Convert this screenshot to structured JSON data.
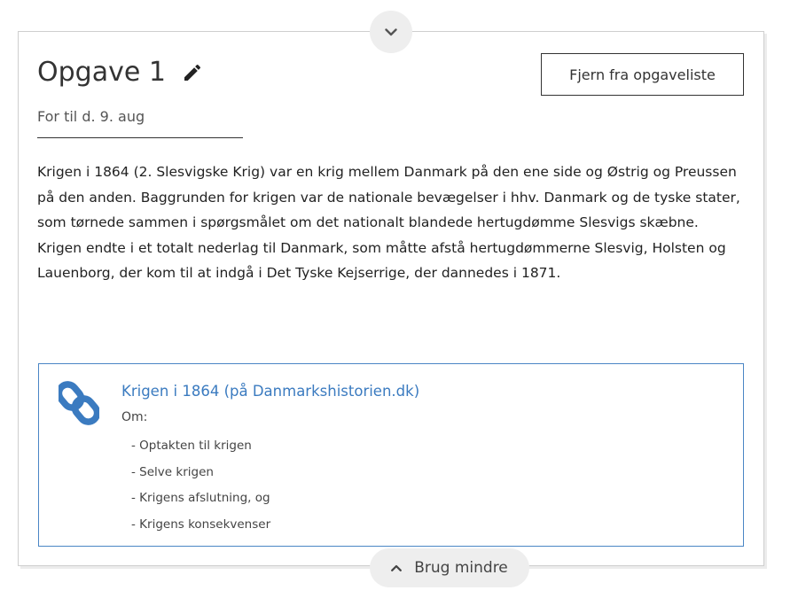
{
  "task": {
    "title": "Opgave 1",
    "due": "For til d. 9. aug",
    "remove_button": "Fjern fra opgaveliste",
    "description": "Krigen i 1864 (2. Slesvigske Krig) var en krig mellem Danmark på den ene side og Østrig og Preussen på den anden. Baggrunden for krigen var de nationale bevægelser i hhv. Danmark og de tyske stater, som tørnede sammen i spørgsmålet om det nationalt blandede hertugdømme Slesvigs skæbne. Krigen endte i et totalt nederlag til Danmark, som måtte afstå hertugdømmerne Slesvig, Holsten og Lauenborg, der kom til at indgå i Det Tyske Kejserrige, der dannedes i 1871."
  },
  "resource": {
    "title": "Krigen i 1864 (på Danmarkshistorien.dk)",
    "subtitle": "Om:",
    "items": [
      "- Optakten til krigen",
      "- Selve krigen",
      "- Krigens afslutning, og",
      "- Krigens konsekvenser"
    ],
    "icon": "link-icon"
  },
  "controls": {
    "collapse_label": "Brug mindre",
    "top_toggle_icon": "chevron-down-icon",
    "bottom_toggle_icon": "chevron-up-icon",
    "edit_icon": "pencil-icon"
  },
  "colors": {
    "link": "#3b7bc0",
    "link_border": "#4a86c5",
    "toggle_bg": "#eeeeee"
  }
}
